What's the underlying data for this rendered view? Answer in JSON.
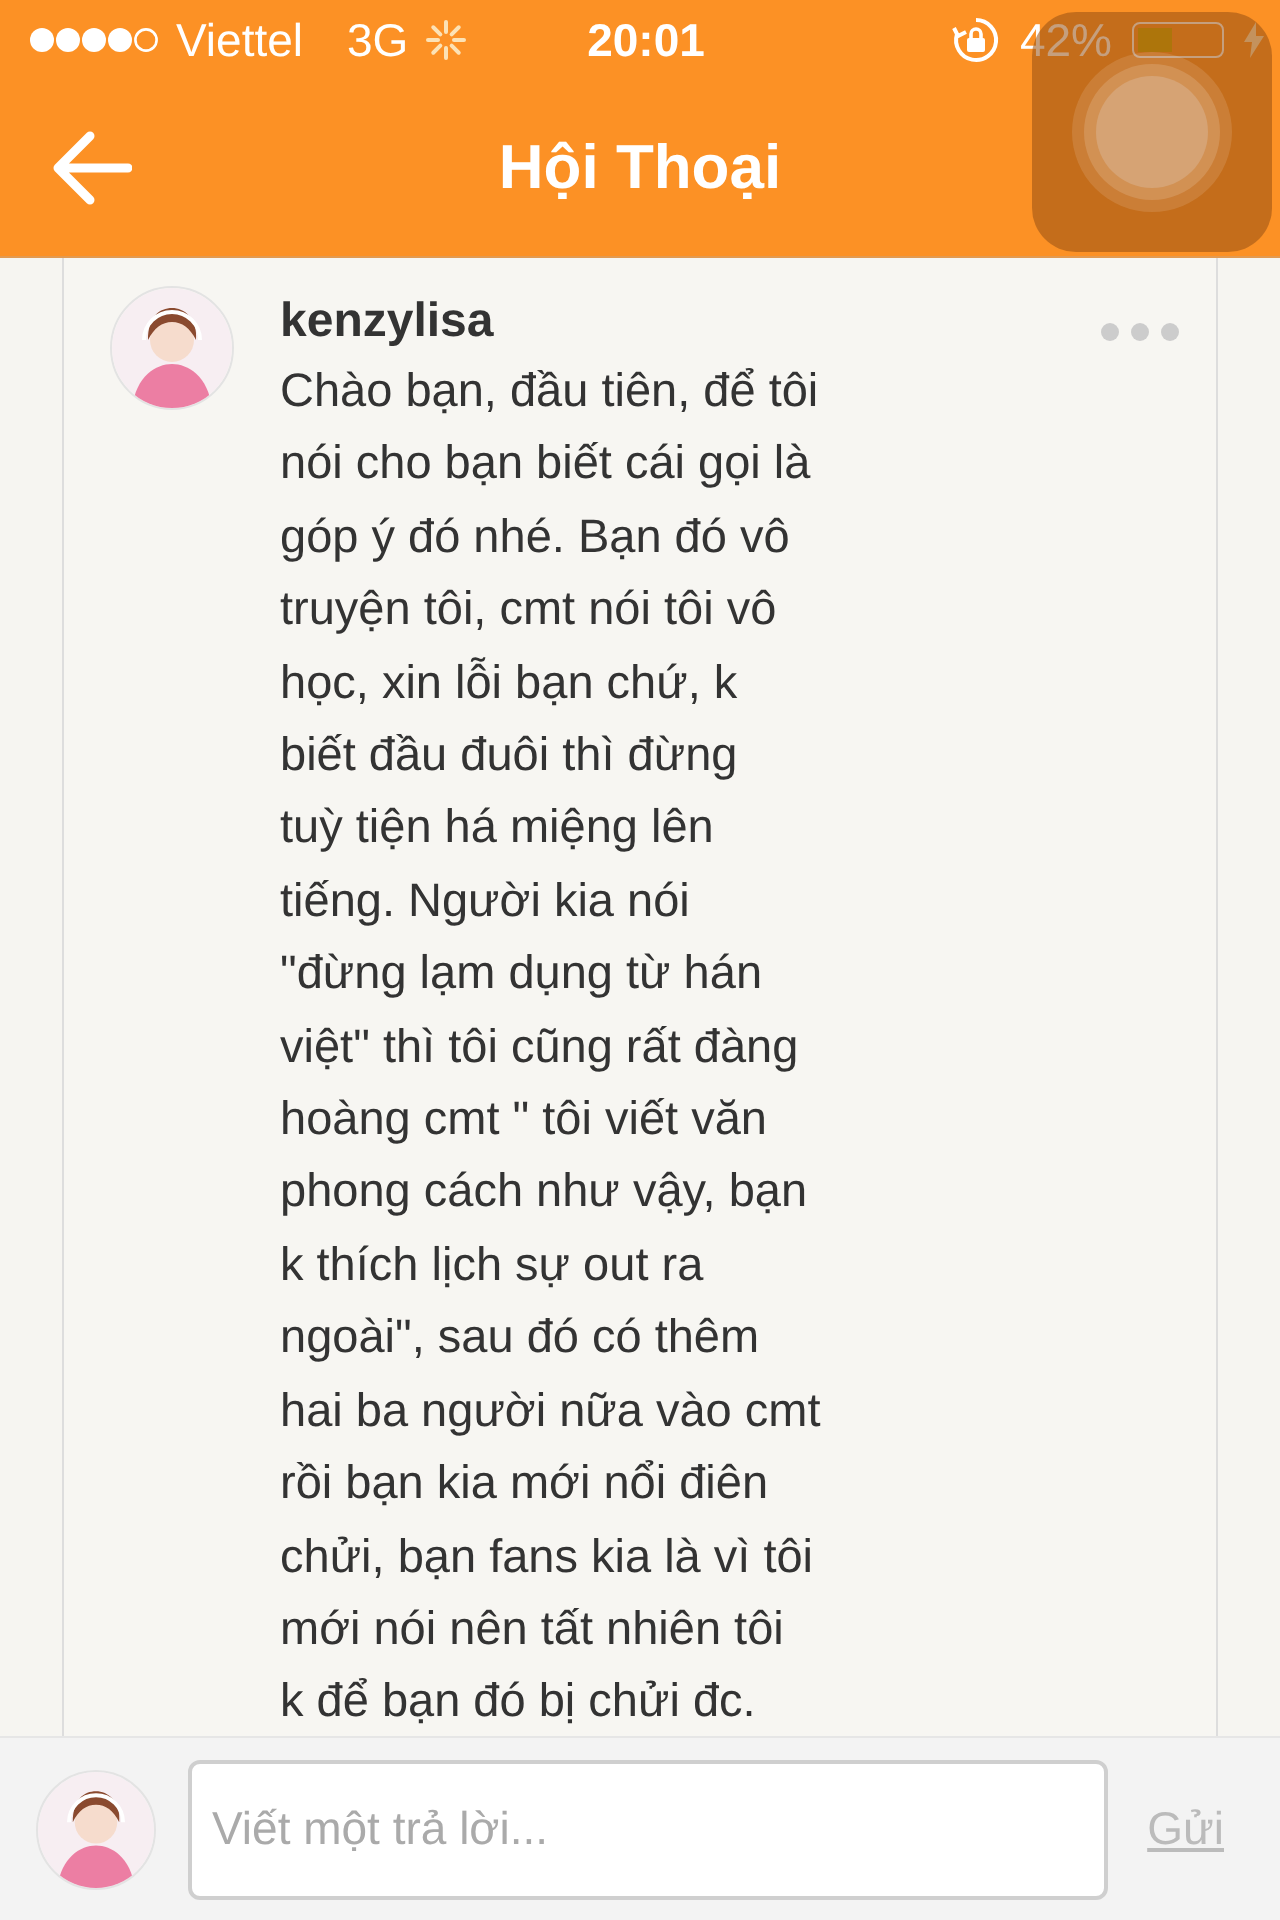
{
  "status_bar": {
    "carrier": "Viettel",
    "network": "3G",
    "time": "20:01",
    "battery": "42%"
  },
  "nav": {
    "title": "Hội Thoại"
  },
  "message": {
    "author": "kenzylisa",
    "text": "Chào bạn, đầu tiên, để tôi\nnói cho bạn biết cái gọi là\ngóp ý đó nhé. Bạn đó vô\ntruyện tôi, cmt nói tôi vô\nhọc, xin lỗi bạn chứ, k\nbiết đầu đuôi thì đừng\ntuỳ tiện há miệng lên\ntiếng. Người kia nói\n\"đừng lạm dụng từ hán\nviệt\" thì tôi cũng rất đàng\nhoàng cmt \" tôi viết văn\nphong cách như vậy, bạn\nk thích lịch sự out ra\nngoài\", sau đó có thêm\nhai ba người nữa vào cmt\nrồi bạn kia mới nổi điên\nchửi, bạn fans kia là vì tôi\nmới nói nên tất nhiên tôi\nk để bạn đó bị chửi đc."
  },
  "reply": {
    "placeholder": "Viết một trả lời...",
    "send": "Gửi",
    "send_disabled": true
  }
}
